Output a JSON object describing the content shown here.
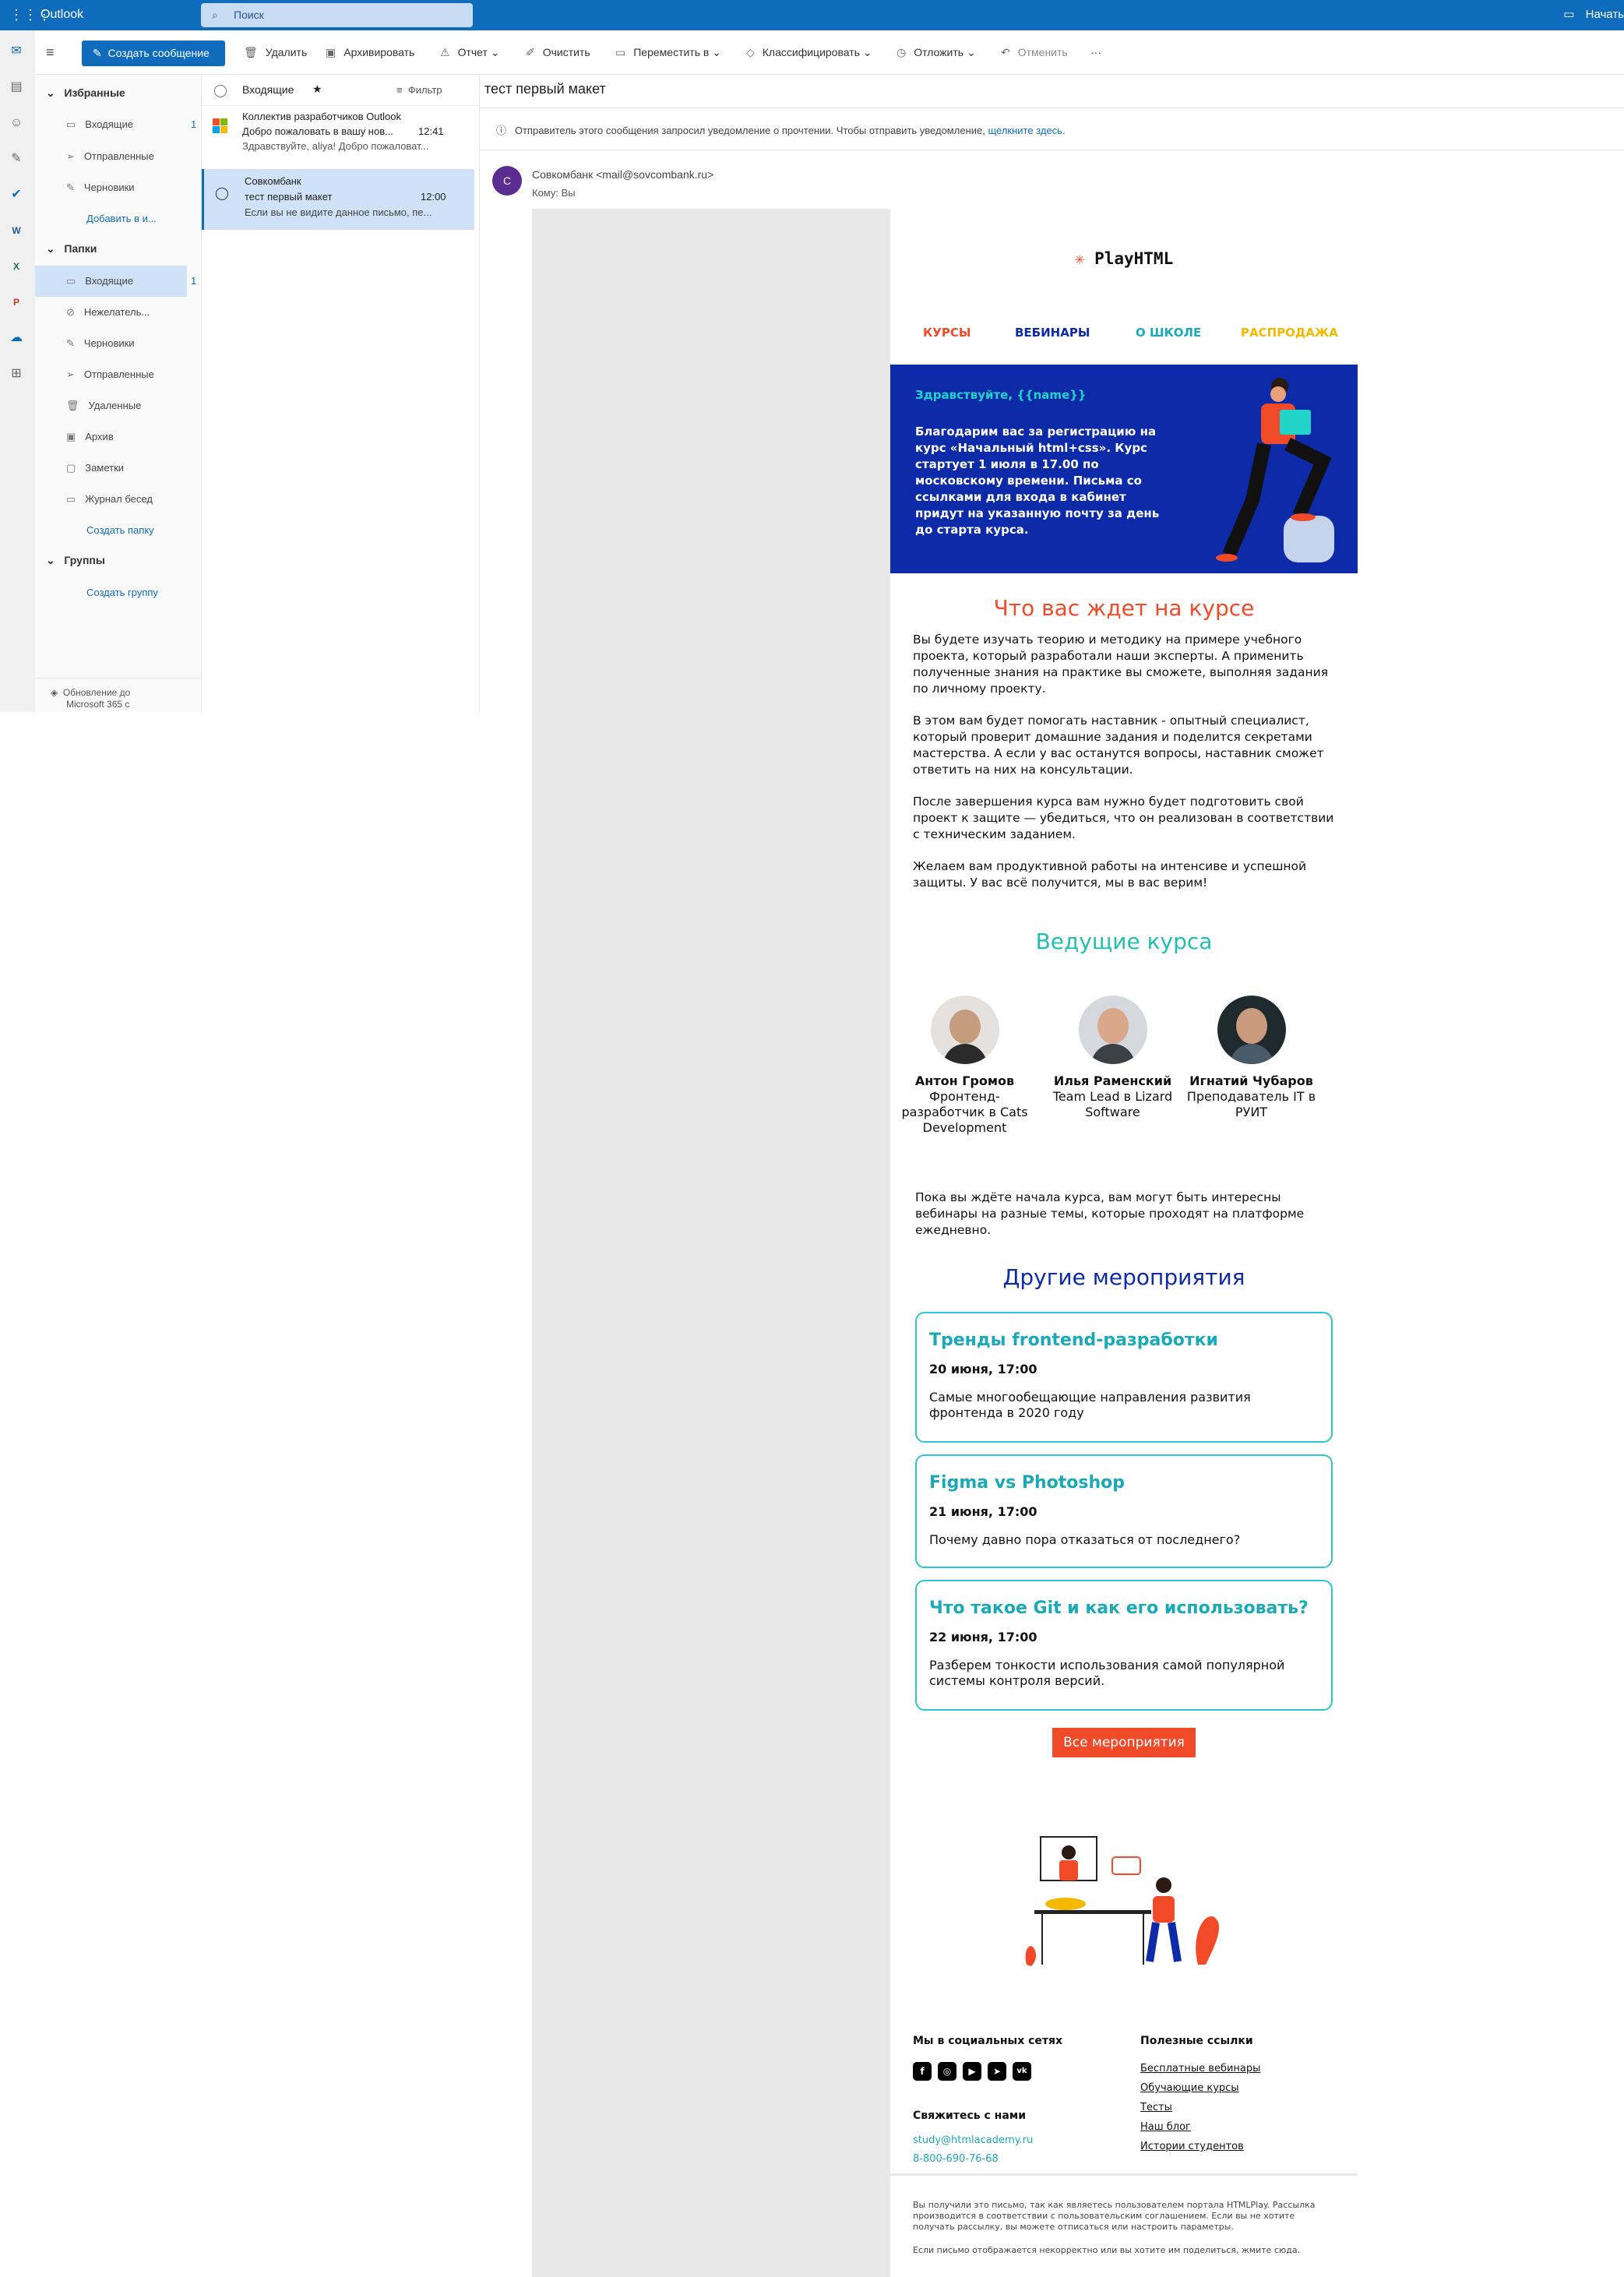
{
  "app": {
    "name": "Outlook",
    "search_placeholder": "Поиск",
    "topright": "Начать"
  },
  "toolbar": {
    "compose": "Создать сообщение",
    "delete": "Удалить",
    "archive": "Архивировать",
    "report": "Отчет",
    "sweep": "Очистить",
    "move": "Переместить в",
    "categorize": "Классифицировать",
    "snooze": "Отложить",
    "undo": "Отменить",
    "more": "···"
  },
  "folders": {
    "favorites_header": "Избранные",
    "fav": [
      "Входящие",
      "Отправленные",
      "Черновики"
    ],
    "fav_inbox_count": "1",
    "add_favorite": "Добавить в и...",
    "folders_header": "Папки",
    "items": [
      "Входящие",
      "Нежелатель...",
      "Черновики",
      "Отправленные",
      "Удаленные",
      "Архив",
      "Заметки",
      "Журнал бесед"
    ],
    "inbox_count": "1",
    "create_folder": "Создать папку",
    "groups_header": "Группы",
    "create_group": "Создать группу",
    "upgrade_line1": "Обновление до",
    "upgrade_line2": "Microsoft 365 с"
  },
  "message_list": {
    "title": "Входящие",
    "filter": "Фильтр",
    "messages": [
      {
        "sender": "Коллектив разработчиков Outlook",
        "subject": "Добро пожаловать в вашу нов...",
        "time": "12:41",
        "preview": "Здравствуйте, aliya! Добро пожаловат..."
      },
      {
        "sender": "Совкомбанк",
        "subject": "тест первый макет",
        "time": "12:00",
        "preview": "Если вы не видите данное письмо, пе..."
      }
    ]
  },
  "reading": {
    "subject": "тест первый макет",
    "notice": "Отправитель этого сообщения запросил уведомление о прочтении. Чтобы отправить уведомление,",
    "notice_link": "щелкните здесь.",
    "avatar_letter": "С",
    "from": "Совкомбанк <mail@sovcombank.ru>",
    "to": "Кому:  Вы"
  },
  "email": {
    "logo": "PlayHTML",
    "nav": [
      {
        "label": "КУРСЫ",
        "color": "#f04a29"
      },
      {
        "label": "ВЕБИНАРЫ",
        "color": "#0d2aa8"
      },
      {
        "label": "О ШКОЛЕ",
        "color": "#19a9b7"
      },
      {
        "label": "РАСПРОДАЖА",
        "color": "#f5b800"
      }
    ],
    "greeting": "Здравствуйте, {{name}}",
    "hero_text": "Благодарим вас за регистрацию на курс «Начальный html+css». Курс стартует 1 июля в 17.00 по московскому времени. Письма со ссылками для входа в кабинет придут на указанную почту за день до старта курса.",
    "course_title": "Что вас ждет на курсе",
    "paragraphs": [
      "Вы будете изучать теорию и методику на примере учебного проекта, который разработали наши эксперты. А применить полученные знания на практике вы сможете, выполняя задания по личному проекту.",
      "В этом вам будет помогать наставник - опытный специалист, который проверит домашние задания и поделится секретами мастерства. А если у вас останутся вопросы, наставник сможет ответить на них на консультации.",
      "После завершения курса вам нужно будет подготовить свой проект к защите — убедиться, что он реализован в соответствии с техническим заданием.",
      "Желаем вам продуктивной работы на интенсиве и успешной защиты. У вас всё получится, мы в вас верим!"
    ],
    "speakers_title": "Ведущие курса",
    "speakers": [
      {
        "name": "Антон Громов",
        "role": "Фронтенд-разработчик в Cats Development"
      },
      {
        "name": "Илья Раменский",
        "role": "Team Lead в Lizard Software"
      },
      {
        "name": "Игнатий Чубаров",
        "role": "Преподаватель IT в РУИТ"
      }
    ],
    "waiting_text": "Пока вы ждёте начала курса, вам могут быть интересны вебинары на разные темы, которые проходят на платформе ежедневно.",
    "events_title": "Другие мероприятия",
    "events": [
      {
        "title": "Тренды frontend-разработки",
        "date": "20 июня, 17:00",
        "desc": "Самые многообещающие направления развития фронтенда в 2020 году"
      },
      {
        "title": "Figma vs Photoshop",
        "date": "21 июня, 17:00",
        "desc": "Почему давно пора отказаться от последнего?"
      },
      {
        "title": "Что такое Git и как его использовать?",
        "date": "22 июня, 17:00",
        "desc": "Разберем тонкости использования самой популярной системы контроля версий."
      }
    ],
    "all_events": "Все мероприятия",
    "social_title": "Мы в социальных сетях",
    "contact_title": "Свяжитесь с нами",
    "email_addr": "study@htmlacademy.ru",
    "phone": "8-800-690-76-68",
    "links_title": "Полезные ссылки",
    "links": [
      "Бесплатные вебинары",
      "Обучающие курсы",
      "Тесты",
      "Наш блог",
      "Истории студентов"
    ],
    "fine1": "Вы получили это письмо, так как являетесь пользователем портала HTMLPlay. Рассылка производится в соответствии с пользовательским соглашением. Если вы не хотите получать рассылку, вы можете отписаться или настроить параметры.",
    "fine2": "Если письмо отображается некорректно или вы хотите им поделиться, жмите сюда."
  }
}
